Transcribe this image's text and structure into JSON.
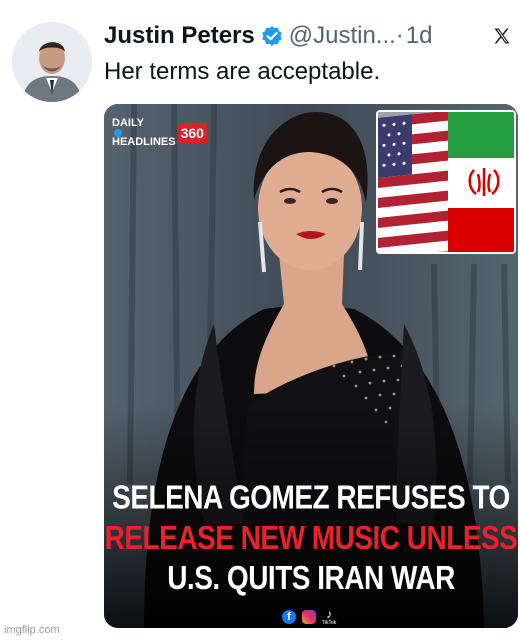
{
  "tweet": {
    "author_name": "Justin Peters",
    "handle": "@Justin...",
    "separator": "·",
    "age": "1d",
    "text": "Her terms are acceptable.",
    "verified": true
  },
  "media": {
    "brand": {
      "line1": "DAILY",
      "line2": "HEADLINES",
      "badge": "360"
    },
    "headline": {
      "line1": "SELENA GOMEZ REFUSES TO",
      "line2": "RELEASE NEW MUSIC UNLESS",
      "line3": "U.S. QUITS IRAN WAR"
    },
    "social_icons": [
      "facebook-icon",
      "instagram-icon",
      "tiktok-icon"
    ],
    "tiktok_label": "TikTok",
    "colors": {
      "headline_red": "#e8212b",
      "brand_red": "#d8232a"
    }
  },
  "watermark": "imgflip.com",
  "colors": {
    "verified_blue": "#1d9bf0",
    "text_primary": "#0f1419",
    "text_secondary": "#536471"
  }
}
